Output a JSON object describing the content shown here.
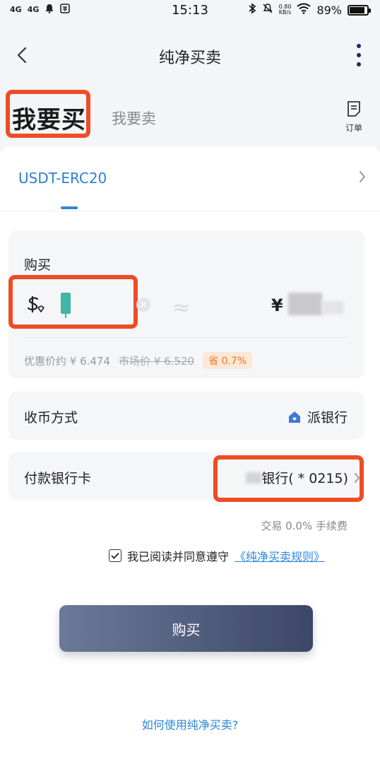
{
  "status_bar": {
    "signal1": "4G",
    "signal2": "4G",
    "time": "15:13",
    "speed_value": "0.80",
    "speed_unit": "KB/s",
    "battery": "89%",
    "battery_level": 0.89
  },
  "nav": {
    "title": "纯净买卖"
  },
  "tabs": {
    "buy": "我要买",
    "sell": "我要卖",
    "orders_label": "订单"
  },
  "coin": {
    "name": "USDT-ERC20"
  },
  "buy_card": {
    "label": "购买",
    "approx_symbol": "≈",
    "currency_symbol": "¥",
    "discount_price": "优惠价约 ¥ 6.474",
    "market_price": "市场价 ¥ 6.520",
    "save_badge": "省 0.7%"
  },
  "receive_method": {
    "label": "收币方式",
    "value": "派银行"
  },
  "payment_card": {
    "label": "付款银行卡",
    "value": "银行( * 0215)"
  },
  "fee_text": "交易 0.0% 手续费",
  "agreement": {
    "text": "我已阅读并同意遵守",
    "link": "《纯净买卖规则》"
  },
  "buy_button": "购买",
  "help_link": "如何使用纯净买卖?",
  "colors": {
    "accent_blue": "#2e86d9",
    "highlight_red": "#ee4c26",
    "save_orange": "#e8772a"
  }
}
